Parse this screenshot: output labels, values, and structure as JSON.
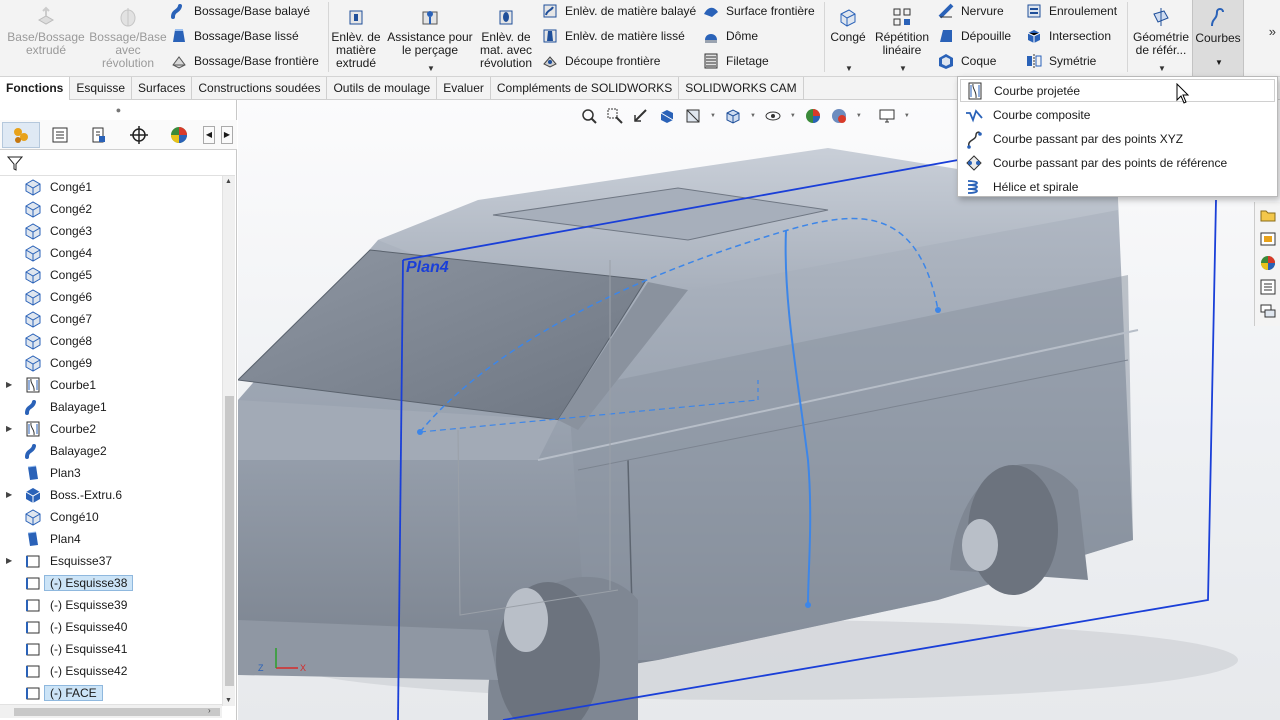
{
  "ribbon": {
    "disabled_buttons": [
      {
        "label_lines": [
          "Base/Bossage",
          "extrudé"
        ]
      },
      {
        "label_lines": [
          "Bossage/Base",
          "avec",
          "révolution"
        ]
      }
    ],
    "bossage_group": [
      "Bossage/Base balayé",
      "Bossage/Base lissé",
      "Bossage/Base frontière"
    ],
    "enlev_extrude": [
      "Enlèv. de",
      "matière",
      "extrudé"
    ],
    "assistance_percage": [
      "Assistance pour",
      "le perçage"
    ],
    "enlev_revolution": [
      "Enlèv. de",
      "mat. avec",
      "révolution"
    ],
    "enlev_group": [
      "Enlèv. de matière balayé",
      "Enlèv. de matière lissé",
      "Découpe frontière"
    ],
    "surface_group": [
      "Surface frontière",
      "Dôme",
      "Filetage"
    ],
    "conge": "Congé",
    "repetition": [
      "Répétition",
      "linéaire"
    ],
    "feature_group_1": [
      "Nervure",
      "Dépouille",
      "Coque"
    ],
    "feature_group_2": [
      "Enroulement",
      "Intersection",
      "Symétrie"
    ],
    "geometrie": [
      "Géométrie",
      "de référ..."
    ],
    "courbes": "Courbes",
    "more_glyph": "»"
  },
  "tabs": [
    {
      "label": "Fonctions",
      "active": true
    },
    {
      "label": "Esquisse"
    },
    {
      "label": "Surfaces"
    },
    {
      "label": "Constructions soudées"
    },
    {
      "label": "Outils de moulage"
    },
    {
      "label": "Evaluer"
    },
    {
      "label": "Compléments de SOLIDWORKS"
    },
    {
      "label": "SOLIDWORKS CAM"
    }
  ],
  "tree": [
    {
      "label": "Congé1",
      "icon": "fillet-icon"
    },
    {
      "label": "Congé2",
      "icon": "fillet-icon"
    },
    {
      "label": "Congé3",
      "icon": "fillet-icon"
    },
    {
      "label": "Congé4",
      "icon": "fillet-icon"
    },
    {
      "label": "Congé5",
      "icon": "fillet-icon"
    },
    {
      "label": "Congé6",
      "icon": "fillet-icon"
    },
    {
      "label": "Congé7",
      "icon": "fillet-icon"
    },
    {
      "label": "Congé8",
      "icon": "fillet-icon"
    },
    {
      "label": "Congé9",
      "icon": "fillet-icon"
    },
    {
      "label": "Courbe1",
      "icon": "projected-curve-icon",
      "expander": true
    },
    {
      "label": "Balayage1",
      "icon": "sweep-icon"
    },
    {
      "label": "Courbe2",
      "icon": "projected-curve-icon",
      "expander": true
    },
    {
      "label": "Balayage2",
      "icon": "sweep-icon"
    },
    {
      "label": "Plan3",
      "icon": "plane-icon"
    },
    {
      "label": "Boss.-Extru.6",
      "icon": "extrude-icon",
      "expander": true
    },
    {
      "label": "Congé10",
      "icon": "fillet-icon"
    },
    {
      "label": "Plan4",
      "icon": "plane-icon"
    },
    {
      "label": "Esquisse37",
      "icon": "sketch-icon",
      "expander": true
    },
    {
      "label": "(-) Esquisse38",
      "icon": "sketch-icon",
      "selected": true
    },
    {
      "label": "(-) Esquisse39",
      "icon": "sketch-icon"
    },
    {
      "label": "(-) Esquisse40",
      "icon": "sketch-icon"
    },
    {
      "label": "(-) Esquisse41",
      "icon": "sketch-icon"
    },
    {
      "label": "(-) Esquisse42",
      "icon": "sketch-icon"
    },
    {
      "label": "(-) FACE",
      "icon": "sketch-icon",
      "selected": true
    }
  ],
  "viewport": {
    "plane_label": "Plan4",
    "triad_labels": [
      "Z",
      "X"
    ]
  },
  "dropdown": [
    {
      "label": "Courbe projetée",
      "icon": "projected-curve-icon",
      "hover": true
    },
    {
      "label": "Courbe composite",
      "icon": "composite-curve-icon"
    },
    {
      "label": "Courbe passant par des points XYZ",
      "icon": "xyz-curve-icon"
    },
    {
      "label": "Courbe passant par des points de référence",
      "icon": "ref-points-curve-icon"
    },
    {
      "label": "Hélice et spirale",
      "icon": "helix-icon"
    }
  ],
  "colors": {
    "accent": "#1f5fbf",
    "sketch_blue": "#3d86e8",
    "selection": "#cce4f7",
    "model_body": "#9aa3b0"
  }
}
